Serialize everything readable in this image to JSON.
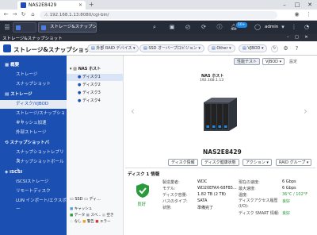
{
  "browser": {
    "tab_title": "NAS2E8429",
    "url": "192.168.1.13:8080/cgi-bin/"
  },
  "qts": {
    "app_name": "ストレージ&スナップショット",
    "user": "admin",
    "notif_count": "10+"
  },
  "header": {
    "title": "ストレージ&スナップショット",
    "chips": [
      "外部 RAID デバイス",
      "SSD オーバープロビジョン",
      "Other",
      "VJBOD"
    ],
    "perf_test": "性能テスト",
    "vjbod_btn": "VJBOD",
    "settings": "設定"
  },
  "sidebar": {
    "items": [
      {
        "label": "概要",
        "cat": true
      },
      {
        "label": "ストレージ"
      },
      {
        "label": "スナップショット"
      },
      {
        "label": "ストレージ",
        "cat": true
      },
      {
        "label": "ディスク/VJBOD",
        "active": true
      },
      {
        "label": "ストレージ/スナップショット"
      },
      {
        "label": "キャッシュ加速"
      },
      {
        "label": "外部ストレージ"
      },
      {
        "label": "スナップショットバ",
        "cat": true
      },
      {
        "label": "スナップショットレプリカ"
      },
      {
        "label": "スナップショットボールト"
      },
      {
        "label": "iSCSI",
        "cat": true
      },
      {
        "label": "iSCSIストレージ"
      },
      {
        "label": "リモートディスク"
      },
      {
        "label": "LUN インポート/エクスポー"
      }
    ]
  },
  "tree": {
    "root": "NAS ホスト",
    "disks": [
      "ディスク1",
      "ディスク2",
      "ディスク3",
      "ディスク4"
    ],
    "legend_line1": "SSD",
    "legend_line2": "ディ...",
    "legend": [
      "キャッシュ",
      "データ",
      "スペ...",
      "空き",
      "なし",
      "警告",
      "エラー"
    ]
  },
  "device": {
    "nas_label": "NAS ホスト",
    "nas_ip": "192.168.1.13",
    "name": "NAS2E8429"
  },
  "actions": [
    "ディスク情報",
    "ディスク健康状態",
    "アクション",
    "RAID グループ"
  ],
  "disk_info": {
    "section": "ディスク 1 情報",
    "health": "良好",
    "left": [
      {
        "label": "製造業者:",
        "value": "WDC"
      },
      {
        "label": "モデル:",
        "value": "WD20EFAX-68FB5..."
      },
      {
        "label": "ディスク容量:",
        "value": "1.82 TB (2 TB)"
      },
      {
        "label": "バスのタイプ:",
        "value": "SATA"
      },
      {
        "label": "状態:",
        "value": "準備完了"
      }
    ],
    "right": [
      {
        "label": "現在の速度:",
        "value": "6 Gbps"
      },
      {
        "label": "最大速度:",
        "value": "6 Gbps"
      },
      {
        "label": "温度:",
        "value": "36°C / 102°F"
      },
      {
        "label": "ディスクアクセス履歴 (I/O):",
        "value": "良好"
      },
      {
        "label": "ディスク SMART 情報:",
        "value": "良好"
      }
    ]
  },
  "colors": {
    "sidebar": "#1b4fb1",
    "qts_bar": "#262b38",
    "good": "#2b9a3c"
  }
}
